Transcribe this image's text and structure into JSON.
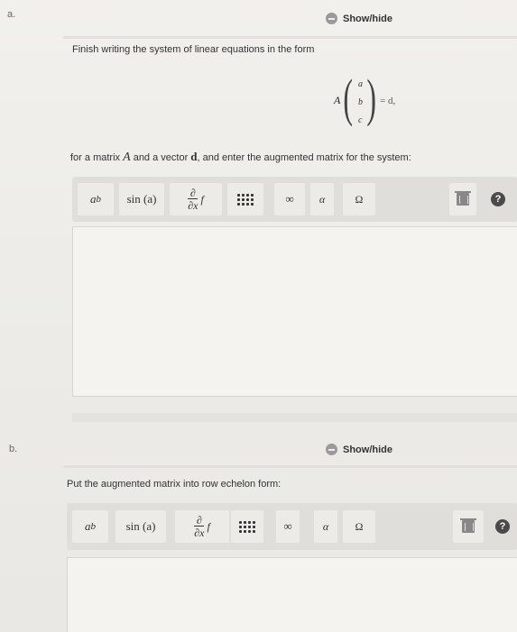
{
  "part_a": {
    "label": "a.",
    "show_hide": "Show/hide",
    "instruction": "Finish writing the system of linear equations in the form",
    "equation": {
      "matrix": "A",
      "vector": [
        "a",
        "b",
        "c"
      ],
      "equals": "= d,"
    },
    "description_prefix": "for a matrix ",
    "description_matrix": "A",
    "description_middle": " and a vector ",
    "description_vector": "d",
    "description_suffix": ", and enter the augmented matrix for the system:",
    "editor_value": ""
  },
  "part_b": {
    "label": "b.",
    "show_hide": "Show/hide",
    "instruction": "Put the augmented matrix into row echelon form:",
    "editor_value": ""
  },
  "toolbar": {
    "power": "a",
    "power_sup": "b",
    "sin": "sin (a)",
    "deriv_num": "∂",
    "deriv_den": "∂x",
    "deriv_f": "f",
    "infinity": "∞",
    "alpha": "α",
    "omega": "Ω",
    "help": "?"
  }
}
